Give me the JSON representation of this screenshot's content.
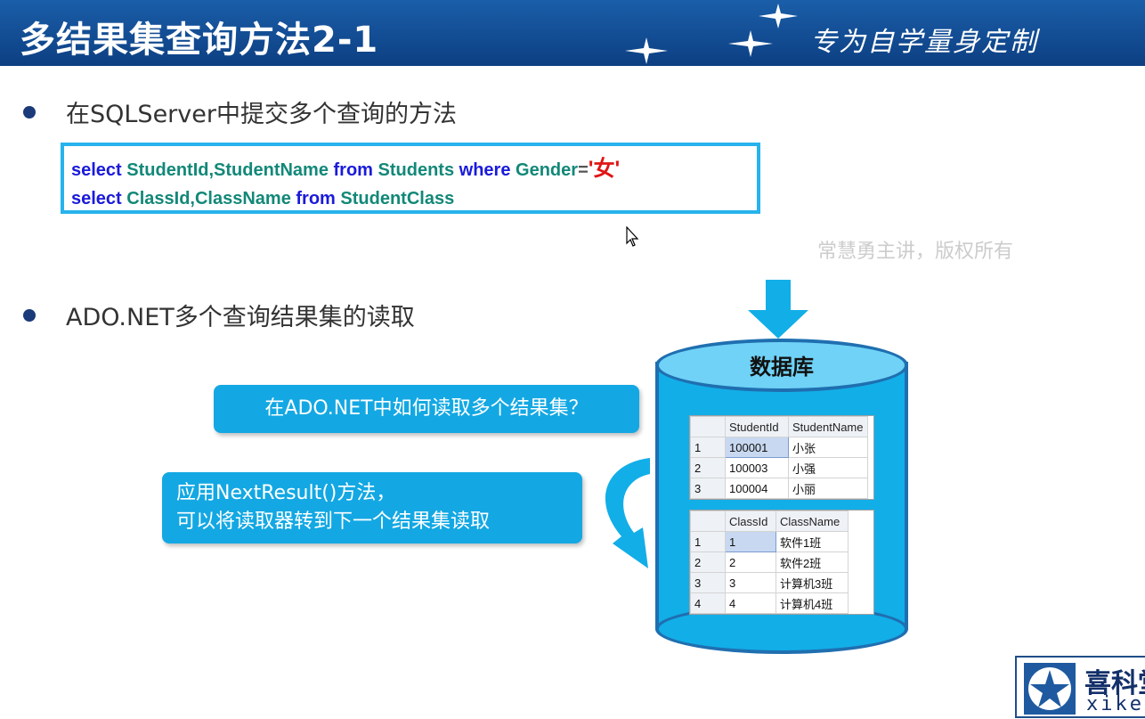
{
  "header": {
    "title": "多结果集查询方法2-1",
    "slogan": "专为自学量身定制"
  },
  "bullets": [
    {
      "text": "在SQLServer中提交多个查询的方法"
    },
    {
      "text": "ADO.NET多个查询结果集的读取"
    }
  ],
  "code": {
    "line1": {
      "kw1": "select",
      "cols": "StudentId,StudentName",
      "kw2": "from",
      "table": "Students",
      "kw3": "where",
      "col": "Gender",
      "op": "=",
      "val": "'女'"
    },
    "line2": {
      "kw1": "select",
      "cols": "ClassId,ClassName",
      "kw2": "from",
      "table": "StudentClass"
    }
  },
  "watermark": "常慧勇主讲，版权所有",
  "database": {
    "label": "数据库",
    "grid1": {
      "headers": [
        "StudentId",
        "StudentName"
      ],
      "rows": [
        {
          "n": "1",
          "c1": "100001",
          "c2": "小张"
        },
        {
          "n": "2",
          "c1": "100003",
          "c2": "小强"
        },
        {
          "n": "3",
          "c1": "100004",
          "c2": "小丽"
        }
      ]
    },
    "grid2": {
      "headers": [
        "ClassId",
        "ClassName"
      ],
      "rows": [
        {
          "n": "1",
          "c1": "1",
          "c2": "软件1班"
        },
        {
          "n": "2",
          "c1": "2",
          "c2": "软件2班"
        },
        {
          "n": "3",
          "c1": "3",
          "c2": "计算机3班"
        },
        {
          "n": "4",
          "c1": "4",
          "c2": "计算机4班"
        }
      ]
    }
  },
  "callouts": {
    "question": "在ADO.NET中如何读取多个结果集？",
    "answer_line1": "应用NextResult()方法，",
    "answer_line2": "可以将读取器转到下一个结果集读取"
  },
  "logo": {
    "cn": "喜科堂",
    "en": "xiketang"
  },
  "colors": {
    "header_bg": "#0d3f82",
    "accent": "#13a8e3",
    "keyword": "#1a1adb",
    "identifier": "#128878",
    "string": "#e01515"
  }
}
